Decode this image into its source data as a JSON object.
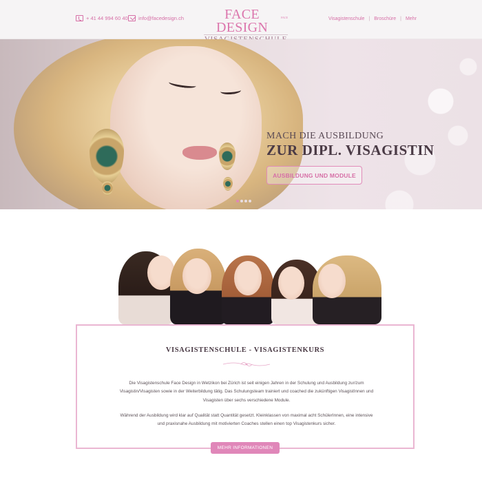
{
  "header": {
    "phone": "+ 41 44 994 60 40",
    "email": "info@facedesign.ch",
    "logo_top": "FACE DESIGN",
    "logo_small": "FACE",
    "logo_bottom": "VISAGISTENSCHULE",
    "nav": [
      {
        "label": "Visagistenschule"
      },
      {
        "label": "Broschüre"
      },
      {
        "label": "Mehr"
      }
    ],
    "nav_separator": "|"
  },
  "hero": {
    "subtitle": "MACH DIE AUSBILDUNG",
    "title": "ZUR DIPL. VISAGISTIN",
    "button_label": "AUSBILDUNG UND MODULE",
    "slides_total": 4,
    "active_slide": 1
  },
  "info": {
    "title": "VISAGISTENSCHULE - VISAGISTENKURS",
    "paragraph1_lines": [
      "Die Visagistenschule Face Design in Wetzikon bei Zürich ist seit einigen Jahren in der Schulung und Ausbildung zur/zum",
      "Visagistin/Visagisten sowie in der Weiterbildung tätig. Das Schulungsteam trainiert und coached die zukünftigen VisagistInnen und",
      "Visagisten über sechs verschiedene Module."
    ],
    "paragraph2_lines": [
      "Während der Ausbildung wird klar auf Qualität statt Quantität gesetzt. Kleinklassen von maximal acht SchülerInnen, eine intensive",
      "und praxisnahe Ausbildung mit motivierten Coaches stellen einen top Visagistenkurs sicher."
    ],
    "button_label": "MEHR INFORMATIONEN"
  },
  "colors": {
    "accent": "#e087b9",
    "heading": "#4a3a45",
    "border": "#eab6d2"
  }
}
